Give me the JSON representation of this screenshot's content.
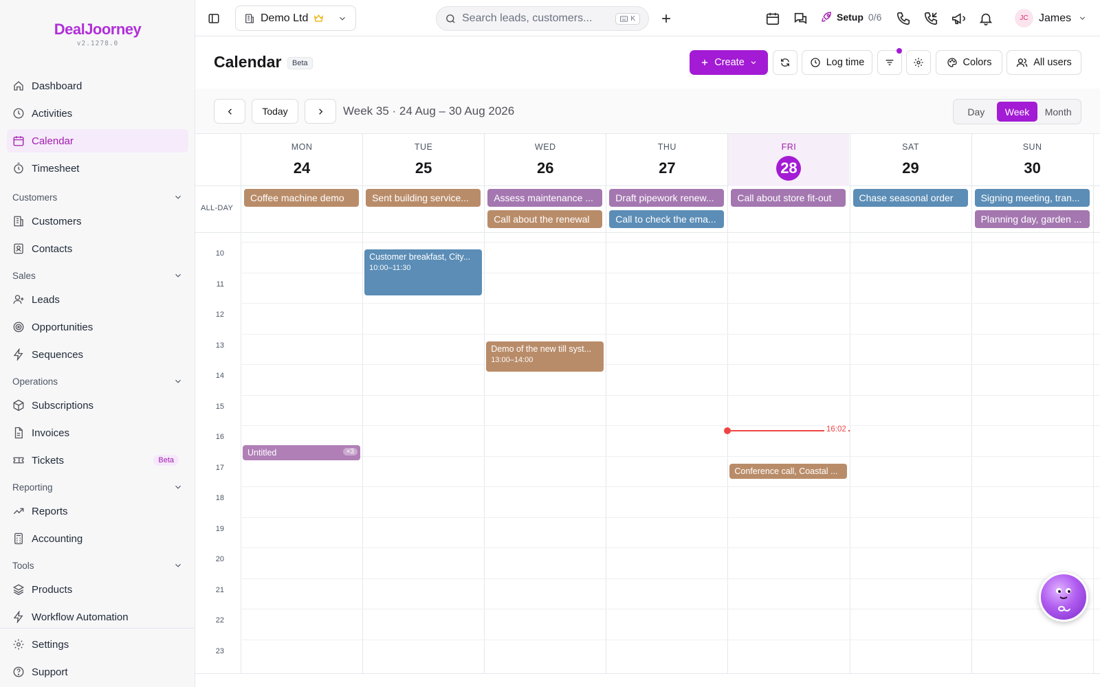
{
  "app": {
    "logo": "DealJoorney",
    "version": "v2.1278.0"
  },
  "sidebar": {
    "items_top": [
      {
        "label": "Dashboard",
        "icon": "home-icon"
      },
      {
        "label": "Activities",
        "icon": "clock-icon"
      },
      {
        "label": "Calendar",
        "icon": "calendar-icon",
        "active": true
      },
      {
        "label": "Timesheet",
        "icon": "timer-icon"
      }
    ],
    "groups": [
      {
        "title": "Customers",
        "items": [
          {
            "label": "Customers",
            "icon": "building-icon"
          },
          {
            "label": "Contacts",
            "icon": "contact-icon"
          }
        ]
      },
      {
        "title": "Sales",
        "items": [
          {
            "label": "Leads",
            "icon": "user-plus-icon"
          },
          {
            "label": "Opportunities",
            "icon": "target-icon"
          },
          {
            "label": "Sequences",
            "icon": "bolt-icon"
          }
        ]
      },
      {
        "title": "Operations",
        "items": [
          {
            "label": "Subscriptions",
            "icon": "box-icon"
          },
          {
            "label": "Invoices",
            "icon": "file-icon"
          },
          {
            "label": "Tickets",
            "icon": "ticket-icon",
            "badge": "Beta"
          }
        ]
      },
      {
        "title": "Reporting",
        "items": [
          {
            "label": "Reports",
            "icon": "trend-icon"
          },
          {
            "label": "Accounting",
            "icon": "calculator-icon"
          }
        ]
      },
      {
        "title": "Tools",
        "items": [
          {
            "label": "Products",
            "icon": "layers-icon"
          },
          {
            "label": "Workflow Automation",
            "icon": "bolt-icon"
          }
        ]
      }
    ],
    "bottom": [
      {
        "label": "Settings",
        "icon": "gear-icon"
      },
      {
        "label": "Support",
        "icon": "help-icon"
      }
    ]
  },
  "topbar": {
    "company": "Demo Ltd",
    "search_placeholder": "Search leads, customers...",
    "search_shortcut": "K",
    "setup_label": "Setup",
    "setup_progress": "0/6",
    "user_initials": "JC",
    "user_name": "James"
  },
  "page": {
    "title": "Calendar",
    "title_badge": "Beta",
    "create_label": "Create",
    "log_time_label": "Log time",
    "colors_label": "Colors",
    "all_users_label": "All users"
  },
  "nav": {
    "today_label": "Today",
    "week_label": "Week 35 · 24 Aug – 30 Aug 2026",
    "views": [
      "Day",
      "Week",
      "Month"
    ],
    "active_view": "Week"
  },
  "calendar": {
    "allday_label": "ALL-DAY",
    "days": [
      {
        "name": "MON",
        "num": "24"
      },
      {
        "name": "TUE",
        "num": "25"
      },
      {
        "name": "WED",
        "num": "26"
      },
      {
        "name": "THU",
        "num": "27"
      },
      {
        "name": "FRI",
        "num": "28",
        "today": true
      },
      {
        "name": "SAT",
        "num": "29"
      },
      {
        "name": "SUN",
        "num": "30"
      }
    ],
    "hours": [
      "10",
      "11",
      "12",
      "13",
      "14",
      "15",
      "16",
      "17",
      "18",
      "19",
      "20",
      "21",
      "22",
      "23"
    ],
    "allday_events": [
      {
        "day": 0,
        "row": 0,
        "title": "Coffee machine demo",
        "color": "#b98c69"
      },
      {
        "day": 1,
        "row": 0,
        "title": "Sent building service...",
        "color": "#b98c69"
      },
      {
        "day": 2,
        "row": 0,
        "title": "Assess maintenance ...",
        "color": "#a477b0"
      },
      {
        "day": 2,
        "row": 1,
        "title": "Call about the renewal",
        "color": "#b98c69"
      },
      {
        "day": 3,
        "row": 0,
        "title": "Draft pipework renew...",
        "color": "#a477b0"
      },
      {
        "day": 3,
        "row": 1,
        "title": "Call to check the ema...",
        "color": "#5b8db6"
      },
      {
        "day": 4,
        "row": 0,
        "title": "Call about store fit-out",
        "color": "#a477b0"
      },
      {
        "day": 5,
        "row": 0,
        "title": "Chase seasonal order",
        "color": "#5b8db6"
      },
      {
        "day": 6,
        "row": 0,
        "title": "Signing meeting, tran...",
        "color": "#5b8db6"
      },
      {
        "day": 6,
        "row": 1,
        "title": "Planning day, garden ...",
        "color": "#a477b0"
      }
    ],
    "timed_events": [
      {
        "day": 1,
        "start": 10,
        "end": 11.5,
        "title": "Customer breakfast, City...",
        "time": "10:00–11:30",
        "color": "#5b8db6"
      },
      {
        "day": 2,
        "start": 13,
        "end": 14,
        "title": "Demo of the new till syst...",
        "time": "13:00–14:00",
        "color": "#b98c69"
      },
      {
        "day": 0,
        "start": 16.4,
        "end": 16.9,
        "title": "Untitled",
        "badge": "×3",
        "color": "#b07fb6"
      },
      {
        "day": 4,
        "start": 17,
        "end": 17.5,
        "title": "Conference call, Coastal ...",
        "color": "#b98c69"
      }
    ],
    "now_time": "16:02"
  }
}
